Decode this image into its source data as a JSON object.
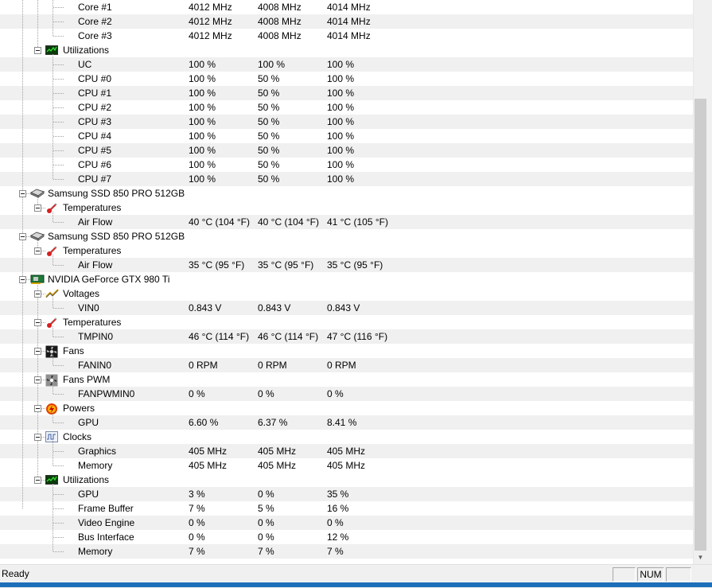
{
  "rows": [
    {
      "label": "Core #1",
      "v": [
        "4012 MHz",
        "4008 MHz",
        "4014 MHz"
      ]
    },
    {
      "label": "Core #2",
      "v": [
        "4012 MHz",
        "4008 MHz",
        "4014 MHz"
      ]
    },
    {
      "label": "Core #3",
      "v": [
        "4012 MHz",
        "4008 MHz",
        "4014 MHz"
      ]
    },
    {
      "label": "Utilizations",
      "icon": "utilization-icon"
    },
    {
      "label": "UC",
      "v": [
        "100 %",
        "100 %",
        "100 %"
      ]
    },
    {
      "label": "CPU #0",
      "v": [
        "100 %",
        "50 %",
        "100 %"
      ]
    },
    {
      "label": "CPU #1",
      "v": [
        "100 %",
        "50 %",
        "100 %"
      ]
    },
    {
      "label": "CPU #2",
      "v": [
        "100 %",
        "50 %",
        "100 %"
      ]
    },
    {
      "label": "CPU #3",
      "v": [
        "100 %",
        "50 %",
        "100 %"
      ]
    },
    {
      "label": "CPU #4",
      "v": [
        "100 %",
        "50 %",
        "100 %"
      ]
    },
    {
      "label": "CPU #5",
      "v": [
        "100 %",
        "50 %",
        "100 %"
      ]
    },
    {
      "label": "CPU #6",
      "v": [
        "100 %",
        "50 %",
        "100 %"
      ]
    },
    {
      "label": "CPU #7",
      "v": [
        "100 %",
        "50 %",
        "100 %"
      ]
    },
    {
      "label": "Samsung SSD 850 PRO 512GB",
      "icon": "disk-icon"
    },
    {
      "label": "Temperatures",
      "icon": "thermometer-icon"
    },
    {
      "label": "Air Flow",
      "v": [
        "40 °C  (104 °F)",
        "40 °C  (104 °F)",
        "41 °C  (105 °F)"
      ]
    },
    {
      "label": "Samsung SSD 850 PRO 512GB",
      "icon": "disk-icon"
    },
    {
      "label": "Temperatures",
      "icon": "thermometer-icon"
    },
    {
      "label": "Air Flow",
      "v": [
        "35 °C  (95 °F)",
        "35 °C  (95 °F)",
        "35 °C  (95 °F)"
      ]
    },
    {
      "label": "NVIDIA GeForce GTX 980 Ti",
      "icon": "gpu-icon"
    },
    {
      "label": "Voltages",
      "icon": "voltage-icon"
    },
    {
      "label": "VIN0",
      "v": [
        "0.843 V",
        "0.843 V",
        "0.843 V"
      ]
    },
    {
      "label": "Temperatures",
      "icon": "thermometer-icon"
    },
    {
      "label": "TMPIN0",
      "v": [
        "46 °C  (114 °F)",
        "46 °C  (114 °F)",
        "47 °C  (116 °F)"
      ]
    },
    {
      "label": "Fans",
      "icon": "fan-icon"
    },
    {
      "label": "FANIN0",
      "v": [
        "0 RPM",
        "0 RPM",
        "0 RPM"
      ]
    },
    {
      "label": "Fans PWM",
      "icon": "fan-pwm-icon"
    },
    {
      "label": "FANPWMIN0",
      "v": [
        "0 %",
        "0 %",
        "0 %"
      ]
    },
    {
      "label": "Powers",
      "icon": "power-icon"
    },
    {
      "label": "GPU",
      "v": [
        "6.60 %",
        "6.37 %",
        "8.41 %"
      ]
    },
    {
      "label": "Clocks",
      "icon": "clock-icon"
    },
    {
      "label": "Graphics",
      "v": [
        "405 MHz",
        "405 MHz",
        "405 MHz"
      ]
    },
    {
      "label": "Memory",
      "v": [
        "405 MHz",
        "405 MHz",
        "405 MHz"
      ]
    },
    {
      "label": "Utilizations",
      "icon": "utilization-icon"
    },
    {
      "label": "GPU",
      "v": [
        "3 %",
        "0 %",
        "35 %"
      ]
    },
    {
      "label": "Frame Buffer",
      "v": [
        "7 %",
        "5 %",
        "16 %"
      ]
    },
    {
      "label": "Video Engine",
      "v": [
        "0 %",
        "0 %",
        "0 %"
      ]
    },
    {
      "label": "Bus Interface",
      "v": [
        "0 %",
        "0 %",
        "12 %"
      ]
    },
    {
      "label": "Memory",
      "v": [
        "7 %",
        "7 %",
        "7 %"
      ]
    }
  ],
  "status": {
    "text": "Ready",
    "num": "NUM"
  }
}
